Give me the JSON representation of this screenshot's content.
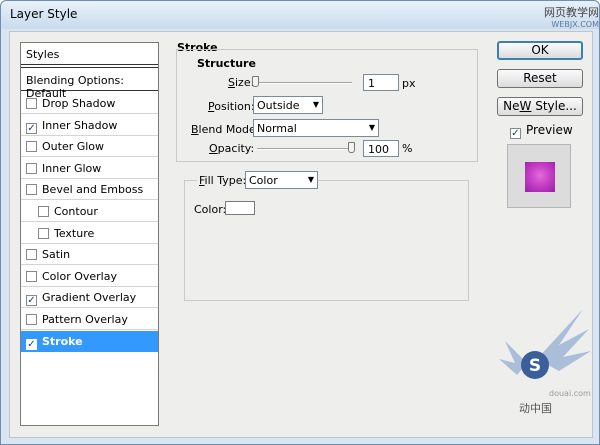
{
  "window": {
    "title": "Layer Style",
    "close_glyph": "X"
  },
  "watermark": {
    "top_text": "网页教学网",
    "top_sub": "WEBJX.COM",
    "bottom_line1": "douai.com",
    "bottom_line2": "动中国"
  },
  "styles": {
    "header": "Styles",
    "blending": "Blending Options: Default",
    "items": [
      {
        "label": "Drop Shadow",
        "checked": false,
        "selected": false,
        "sub": false
      },
      {
        "label": "Inner Shadow",
        "checked": true,
        "selected": false,
        "sub": false
      },
      {
        "label": "Outer Glow",
        "checked": false,
        "selected": false,
        "sub": false
      },
      {
        "label": "Inner Glow",
        "checked": false,
        "selected": false,
        "sub": false
      },
      {
        "label": "Bevel and Emboss",
        "checked": false,
        "selected": false,
        "sub": false
      },
      {
        "label": "Contour",
        "checked": false,
        "selected": false,
        "sub": true
      },
      {
        "label": "Texture",
        "checked": false,
        "selected": false,
        "sub": true
      },
      {
        "label": "Satin",
        "checked": false,
        "selected": false,
        "sub": false
      },
      {
        "label": "Color Overlay",
        "checked": false,
        "selected": false,
        "sub": false
      },
      {
        "label": "Gradient Overlay",
        "checked": true,
        "selected": false,
        "sub": false
      },
      {
        "label": "Pattern Overlay",
        "checked": false,
        "selected": false,
        "sub": false
      },
      {
        "label": "Stroke",
        "checked": true,
        "selected": true,
        "sub": false
      }
    ]
  },
  "stroke": {
    "title": "Stroke",
    "structure_title": "Structure",
    "size": {
      "label_u": "S",
      "label_rest": "ize:",
      "value": "1",
      "unit": "px",
      "fraction": 0.0
    },
    "position": {
      "label_u": "P",
      "label_rest": "osition:",
      "value": "Outside"
    },
    "blend_mode": {
      "label_pre": "",
      "label_u": "B",
      "label_rest": "lend Mode:",
      "value": "Normal"
    },
    "opacity": {
      "label_u": "O",
      "label_rest": "pacity:",
      "value": "100",
      "unit": "%",
      "fraction": 1.0
    },
    "fill_type": {
      "label_u": "F",
      "label_rest": "ill Type:",
      "value": "Color"
    },
    "color": {
      "label": "Color:",
      "value": "#ffffff"
    }
  },
  "buttons": {
    "ok": "OK",
    "reset": "Reset",
    "new_style_u": "W",
    "new_style_pre": "Ne",
    "new_style_rest": " Style...",
    "preview_label": "Preview",
    "preview_checked": true
  },
  "colors": {
    "selection": "#3399ff",
    "preview_center": "#e46cd9",
    "preview_edge": "#9a1fa8"
  }
}
